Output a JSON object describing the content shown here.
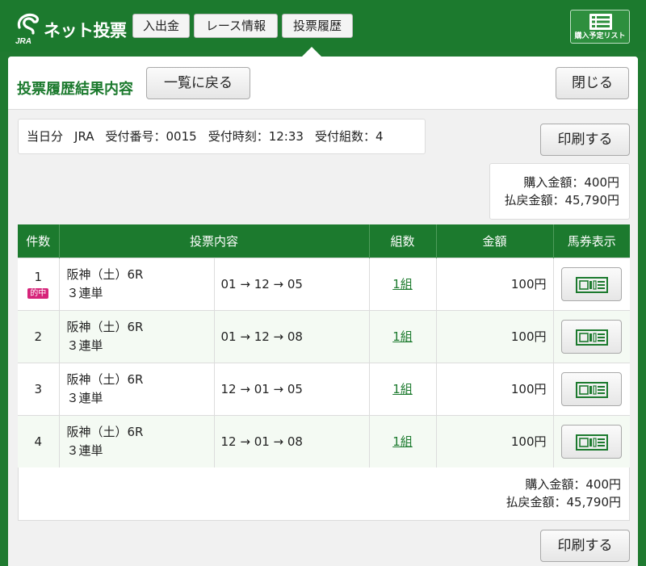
{
  "header": {
    "logo_sub": "JRA",
    "logo_text": "ネット投票",
    "nav": [
      "入出金",
      "レース情報",
      "投票履歴"
    ],
    "cart_label": "購入予定リスト"
  },
  "modal": {
    "title": "投票履歴結果内容",
    "back_label": "一覧に戻る",
    "close_label": "閉じる",
    "print_label": "印刷する",
    "receipt": {
      "day": "当日分",
      "org": "JRA",
      "number": "受付番号：0015",
      "time": "受付時刻：12:33",
      "sets": "受付組数：4"
    },
    "summary": {
      "purchase": "購入金額：400円",
      "payout": "払戻金額：45,790円"
    }
  },
  "table": {
    "headers": [
      "件数",
      "投票内容",
      "組数",
      "金額",
      "馬券表示"
    ],
    "rows": [
      {
        "no": "1",
        "hit": "的中",
        "race": "阪神（土）6R",
        "type": "３連単",
        "content": "01 → 12 → 05",
        "count": "1組",
        "amount": "100円"
      },
      {
        "no": "2",
        "hit": "",
        "race": "阪神（土）6R",
        "type": "３連単",
        "content": "01 → 12 → 08",
        "count": "1組",
        "amount": "100円"
      },
      {
        "no": "3",
        "hit": "",
        "race": "阪神（土）6R",
        "type": "３連単",
        "content": "12 → 01 → 05",
        "count": "1組",
        "amount": "100円"
      },
      {
        "no": "4",
        "hit": "",
        "race": "阪神（土）6R",
        "type": "３連単",
        "content": "12 → 01 → 08",
        "count": "1組",
        "amount": "100円"
      }
    ]
  },
  "colors": {
    "brand_green": "#1c7a2e",
    "hit_badge": "#d6247a"
  }
}
